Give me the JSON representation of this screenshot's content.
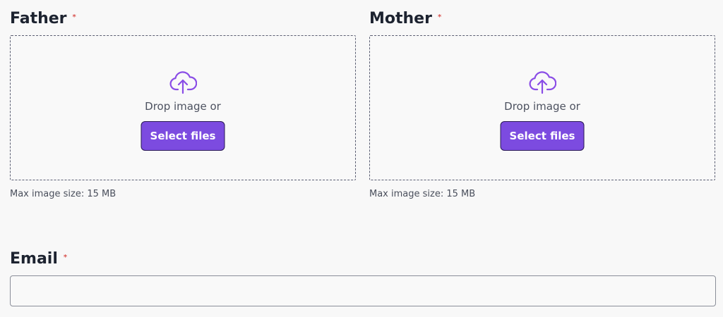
{
  "father": {
    "label": "Father",
    "required_mark": "*",
    "drop_text": "Drop image or",
    "select_label": "Select files",
    "hint": "Max image size: 15 MB"
  },
  "mother": {
    "label": "Mother",
    "required_mark": "*",
    "drop_text": "Drop image or",
    "select_label": "Select files",
    "hint": "Max image size: 15 MB"
  },
  "email": {
    "label": "Email",
    "required_mark": "*",
    "value": ""
  },
  "colors": {
    "accent": "#7c4be0",
    "required": "#d9534f"
  },
  "icons": {
    "upload": "cloud-upload-icon"
  }
}
